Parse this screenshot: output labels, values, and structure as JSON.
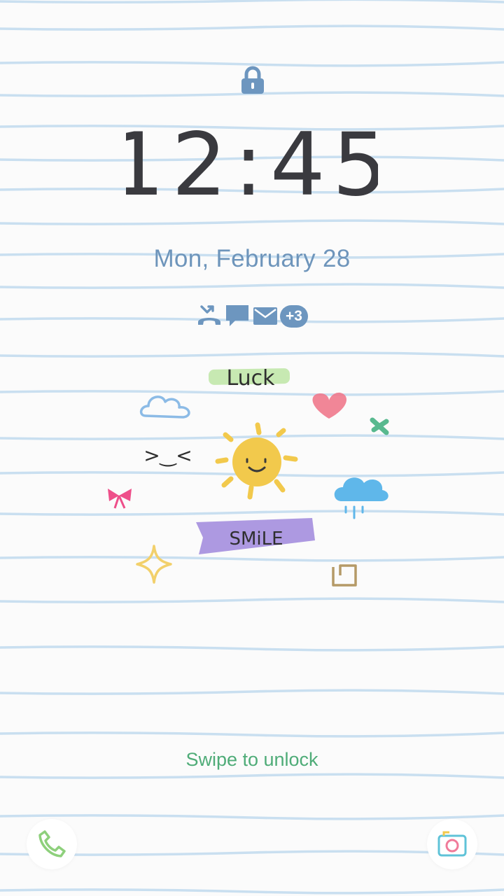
{
  "lockscreen": {
    "time": "12:45",
    "date": "Mon, February 28",
    "notifications": {
      "icons": [
        "missed-call-icon",
        "message-icon",
        "email-icon"
      ],
      "more_count": "+3"
    },
    "wallpaper": {
      "words": [
        "Luck",
        "SMiLE"
      ],
      "emoticon": ">‿<"
    },
    "swipe_hint": "Swipe to unlock",
    "shortcuts": {
      "left": "phone-icon",
      "right": "camera-icon"
    }
  },
  "colors": {
    "line": "#c9dff0",
    "accent_blue": "#6e95bb",
    "clock": "#3a3a3f",
    "swipe_text": "#4fac78"
  }
}
